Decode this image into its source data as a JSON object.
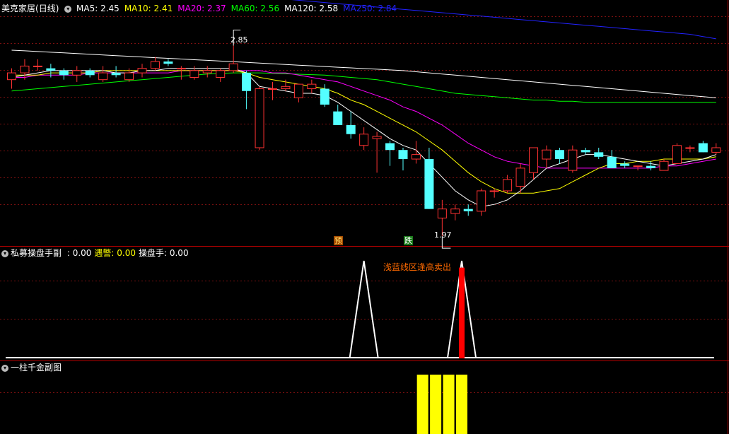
{
  "header": {
    "stock_name": "美克家居",
    "period": "(日线)",
    "ma": [
      {
        "label": "MA5:",
        "value": "2.45",
        "color": "#ffffff"
      },
      {
        "label": "MA10:",
        "value": "2.41",
        "color": "#ffff00"
      },
      {
        "label": "MA20:",
        "value": "2.37",
        "color": "#ff00ff"
      },
      {
        "label": "MA60:",
        "value": "2.56",
        "color": "#00ff00"
      },
      {
        "label": "MA120:",
        "value": "2.58",
        "color": "#ffffff"
      },
      {
        "label": "MA250:",
        "value": "2.84",
        "color": "#2222ff"
      }
    ]
  },
  "annotations": {
    "high_label": "2.85",
    "low_label": "1.97",
    "tag_pre": "预",
    "tag_drop": "跌",
    "sell_note": "浅蓝线区逢高卖出"
  },
  "sub1": {
    "name": "私募操盘手副",
    "items": [
      {
        "label": ":",
        "value": "0.00",
        "color": "#ffffff"
      },
      {
        "label": "遇警:",
        "value": "0.00",
        "color": "#ffff00"
      },
      {
        "label": "操盘手:",
        "value": "0.00",
        "color": "#ffffff"
      }
    ]
  },
  "sub2": {
    "name": "一柱千金副图"
  },
  "colors": {
    "up": "#ff3232",
    "down": "#54ffff",
    "grid": "#7a1010",
    "axis": "#b00000",
    "ma5": "#ffffff",
    "ma10": "#ffff00",
    "ma20": "#ff00ff",
    "ma60": "#00ff00",
    "ma120": "#ffffff",
    "ma250": "#2222ff",
    "bar_yellow": "#ffff00",
    "spike_red": "#ff0000"
  },
  "chart_data": {
    "type": "candlestick",
    "ylim": [
      1.93,
      2.98
    ],
    "candles": [
      [
        2.66,
        2.71,
        2.62,
        2.69
      ],
      [
        2.69,
        2.75,
        2.66,
        2.72
      ],
      [
        2.72,
        2.75,
        2.7,
        2.72
      ],
      [
        2.71,
        2.73,
        2.67,
        2.7
      ],
      [
        2.7,
        2.71,
        2.66,
        2.68
      ],
      [
        2.68,
        2.72,
        2.65,
        2.7
      ],
      [
        2.7,
        2.71,
        2.67,
        2.68
      ],
      [
        2.66,
        2.72,
        2.65,
        2.69
      ],
      [
        2.69,
        2.72,
        2.67,
        2.68
      ],
      [
        2.66,
        2.71,
        2.65,
        2.69
      ],
      [
        2.69,
        2.73,
        2.67,
        2.71
      ],
      [
        2.71,
        2.76,
        2.7,
        2.74
      ],
      [
        2.74,
        2.75,
        2.72,
        2.73
      ],
      [
        2.71,
        2.72,
        2.66,
        2.71
      ],
      [
        2.67,
        2.72,
        2.66,
        2.7
      ],
      [
        2.69,
        2.72,
        2.67,
        2.7
      ],
      [
        2.67,
        2.71,
        2.65,
        2.7
      ],
      [
        2.7,
        2.81,
        2.69,
        2.73
      ],
      [
        2.69,
        2.7,
        2.53,
        2.61
      ],
      [
        2.36,
        2.63,
        2.35,
        2.62
      ],
      [
        2.62,
        2.65,
        2.57,
        2.62
      ],
      [
        2.62,
        2.66,
        2.61,
        2.63
      ],
      [
        2.58,
        2.64,
        2.56,
        2.64
      ],
      [
        2.62,
        2.66,
        2.6,
        2.64
      ],
      [
        2.62,
        2.64,
        2.54,
        2.55
      ],
      [
        2.52,
        2.55,
        2.46,
        2.46
      ],
      [
        2.46,
        2.52,
        2.4,
        2.42
      ],
      [
        2.37,
        2.45,
        2.35,
        2.42
      ],
      [
        2.4,
        2.43,
        2.25,
        2.41
      ],
      [
        2.38,
        2.39,
        2.28,
        2.35
      ],
      [
        2.35,
        2.36,
        2.26,
        2.31
      ],
      [
        2.31,
        2.39,
        2.29,
        2.33
      ],
      [
        2.31,
        2.36,
        2.09,
        2.09
      ],
      [
        2.05,
        2.13,
        1.97,
        2.09
      ],
      [
        2.07,
        2.11,
        2.04,
        2.09
      ],
      [
        2.09,
        2.11,
        2.06,
        2.08
      ],
      [
        2.08,
        2.18,
        2.06,
        2.17
      ],
      [
        2.17,
        2.18,
        2.14,
        2.17
      ],
      [
        2.17,
        2.24,
        2.16,
        2.22
      ],
      [
        2.19,
        2.29,
        2.16,
        2.27
      ],
      [
        2.25,
        2.35,
        2.22,
        2.36
      ],
      [
        2.31,
        2.37,
        2.27,
        2.35
      ],
      [
        2.35,
        2.36,
        2.29,
        2.31
      ],
      [
        2.26,
        2.37,
        2.25,
        2.35
      ],
      [
        2.35,
        2.36,
        2.33,
        2.34
      ],
      [
        2.34,
        2.36,
        2.31,
        2.32
      ],
      [
        2.32,
        2.35,
        2.27,
        2.27
      ],
      [
        2.29,
        2.3,
        2.27,
        2.28
      ],
      [
        2.28,
        2.28,
        2.26,
        2.28
      ],
      [
        2.28,
        2.3,
        2.26,
        2.27
      ],
      [
        2.26,
        2.31,
        2.26,
        2.3
      ],
      [
        2.29,
        2.38,
        2.29,
        2.37
      ],
      [
        2.36,
        2.37,
        2.34,
        2.36
      ],
      [
        2.38,
        2.39,
        2.34,
        2.34
      ],
      [
        2.34,
        2.38,
        2.33,
        2.36
      ]
    ],
    "ma5": [
      2.67,
      2.68,
      2.69,
      2.7,
      2.7,
      2.7,
      2.7,
      2.7,
      2.69,
      2.69,
      2.7,
      2.7,
      2.71,
      2.71,
      2.71,
      2.71,
      2.71,
      2.71,
      2.69,
      2.63,
      2.62,
      2.61,
      2.6,
      2.6,
      2.59,
      2.56,
      2.52,
      2.48,
      2.44,
      2.4,
      2.37,
      2.35,
      2.29,
      2.23,
      2.17,
      2.13,
      2.1,
      2.11,
      2.13,
      2.17,
      2.22,
      2.27,
      2.29,
      2.31,
      2.33,
      2.33,
      2.32,
      2.31,
      2.3,
      2.29,
      2.28,
      2.29,
      2.3,
      2.31,
      2.33
    ],
    "ma10": [
      2.68,
      2.68,
      2.68,
      2.69,
      2.69,
      2.69,
      2.69,
      2.7,
      2.7,
      2.7,
      2.7,
      2.7,
      2.7,
      2.7,
      2.7,
      2.7,
      2.7,
      2.7,
      2.69,
      2.67,
      2.66,
      2.65,
      2.64,
      2.63,
      2.62,
      2.6,
      2.57,
      2.55,
      2.52,
      2.49,
      2.46,
      2.43,
      2.39,
      2.35,
      2.3,
      2.25,
      2.21,
      2.18,
      2.16,
      2.16,
      2.16,
      2.17,
      2.18,
      2.21,
      2.24,
      2.27,
      2.29,
      2.29,
      2.3,
      2.3,
      2.31,
      2.31,
      2.31,
      2.31,
      2.32
    ],
    "ma20": [
      2.67,
      2.67,
      2.68,
      2.68,
      2.68,
      2.68,
      2.69,
      2.69,
      2.69,
      2.69,
      2.69,
      2.69,
      2.69,
      2.7,
      2.7,
      2.7,
      2.7,
      2.7,
      2.7,
      2.7,
      2.69,
      2.69,
      2.68,
      2.67,
      2.66,
      2.65,
      2.63,
      2.61,
      2.59,
      2.57,
      2.54,
      2.52,
      2.49,
      2.46,
      2.42,
      2.38,
      2.35,
      2.32,
      2.3,
      2.29,
      2.28,
      2.27,
      2.27,
      2.27,
      2.27,
      2.27,
      2.27,
      2.27,
      2.27,
      2.27,
      2.28,
      2.28,
      2.29,
      2.3,
      2.31
    ],
    "ma60": [
      2.61,
      2.615,
      2.62,
      2.625,
      2.63,
      2.635,
      2.64,
      2.645,
      2.65,
      2.655,
      2.66,
      2.665,
      2.67,
      2.675,
      2.68,
      2.685,
      2.688,
      2.69,
      2.69,
      2.69,
      2.688,
      2.686,
      2.684,
      2.682,
      2.68,
      2.675,
      2.67,
      2.665,
      2.66,
      2.65,
      2.64,
      2.63,
      2.62,
      2.61,
      2.6,
      2.595,
      2.59,
      2.585,
      2.58,
      2.575,
      2.57,
      2.57,
      2.565,
      2.565,
      2.56,
      2.56,
      2.56,
      2.56,
      2.56,
      2.56,
      2.56,
      2.56,
      2.56,
      2.56,
      2.56
    ],
    "ma120": [
      2.79,
      2.787,
      2.784,
      2.781,
      2.778,
      2.775,
      2.772,
      2.769,
      2.766,
      2.763,
      2.76,
      2.757,
      2.754,
      2.751,
      2.748,
      2.745,
      2.742,
      2.739,
      2.736,
      2.733,
      2.73,
      2.727,
      2.724,
      2.721,
      2.718,
      2.715,
      2.712,
      2.709,
      2.706,
      2.703,
      2.7,
      2.695,
      2.69,
      2.685,
      2.68,
      2.675,
      2.67,
      2.665,
      2.66,
      2.655,
      2.65,
      2.645,
      2.64,
      2.635,
      2.63,
      2.625,
      2.62,
      2.615,
      2.61,
      2.605,
      2.6,
      2.595,
      2.59,
      2.585,
      2.58
    ],
    "ma250": [
      3.12,
      3.115,
      3.11,
      3.105,
      3.1,
      3.095,
      3.09,
      3.085,
      3.08,
      3.075,
      3.07,
      3.065,
      3.06,
      3.055,
      3.05,
      3.045,
      3.04,
      3.035,
      3.03,
      3.025,
      3.02,
      3.015,
      3.01,
      3.005,
      3.0,
      2.995,
      2.99,
      2.985,
      2.98,
      2.975,
      2.97,
      2.965,
      2.96,
      2.955,
      2.95,
      2.945,
      2.94,
      2.935,
      2.93,
      2.925,
      2.92,
      2.915,
      2.91,
      2.905,
      2.9,
      2.895,
      2.89,
      2.885,
      2.88,
      2.875,
      2.87,
      2.865,
      2.86,
      2.85,
      2.84
    ],
    "high_index": 17,
    "low_index": 33,
    "pre_tag_index": 26,
    "drop_tag_index": 32,
    "signal_white": [
      {
        "center": 27,
        "value": 1.0
      },
      {
        "center": 34.5,
        "value": 1.0
      }
    ],
    "signal_red": [
      {
        "index": 34.5,
        "value": 0.93
      }
    ],
    "signal_yellow": [
      31.5,
      32.5,
      33.5,
      34.5
    ]
  }
}
